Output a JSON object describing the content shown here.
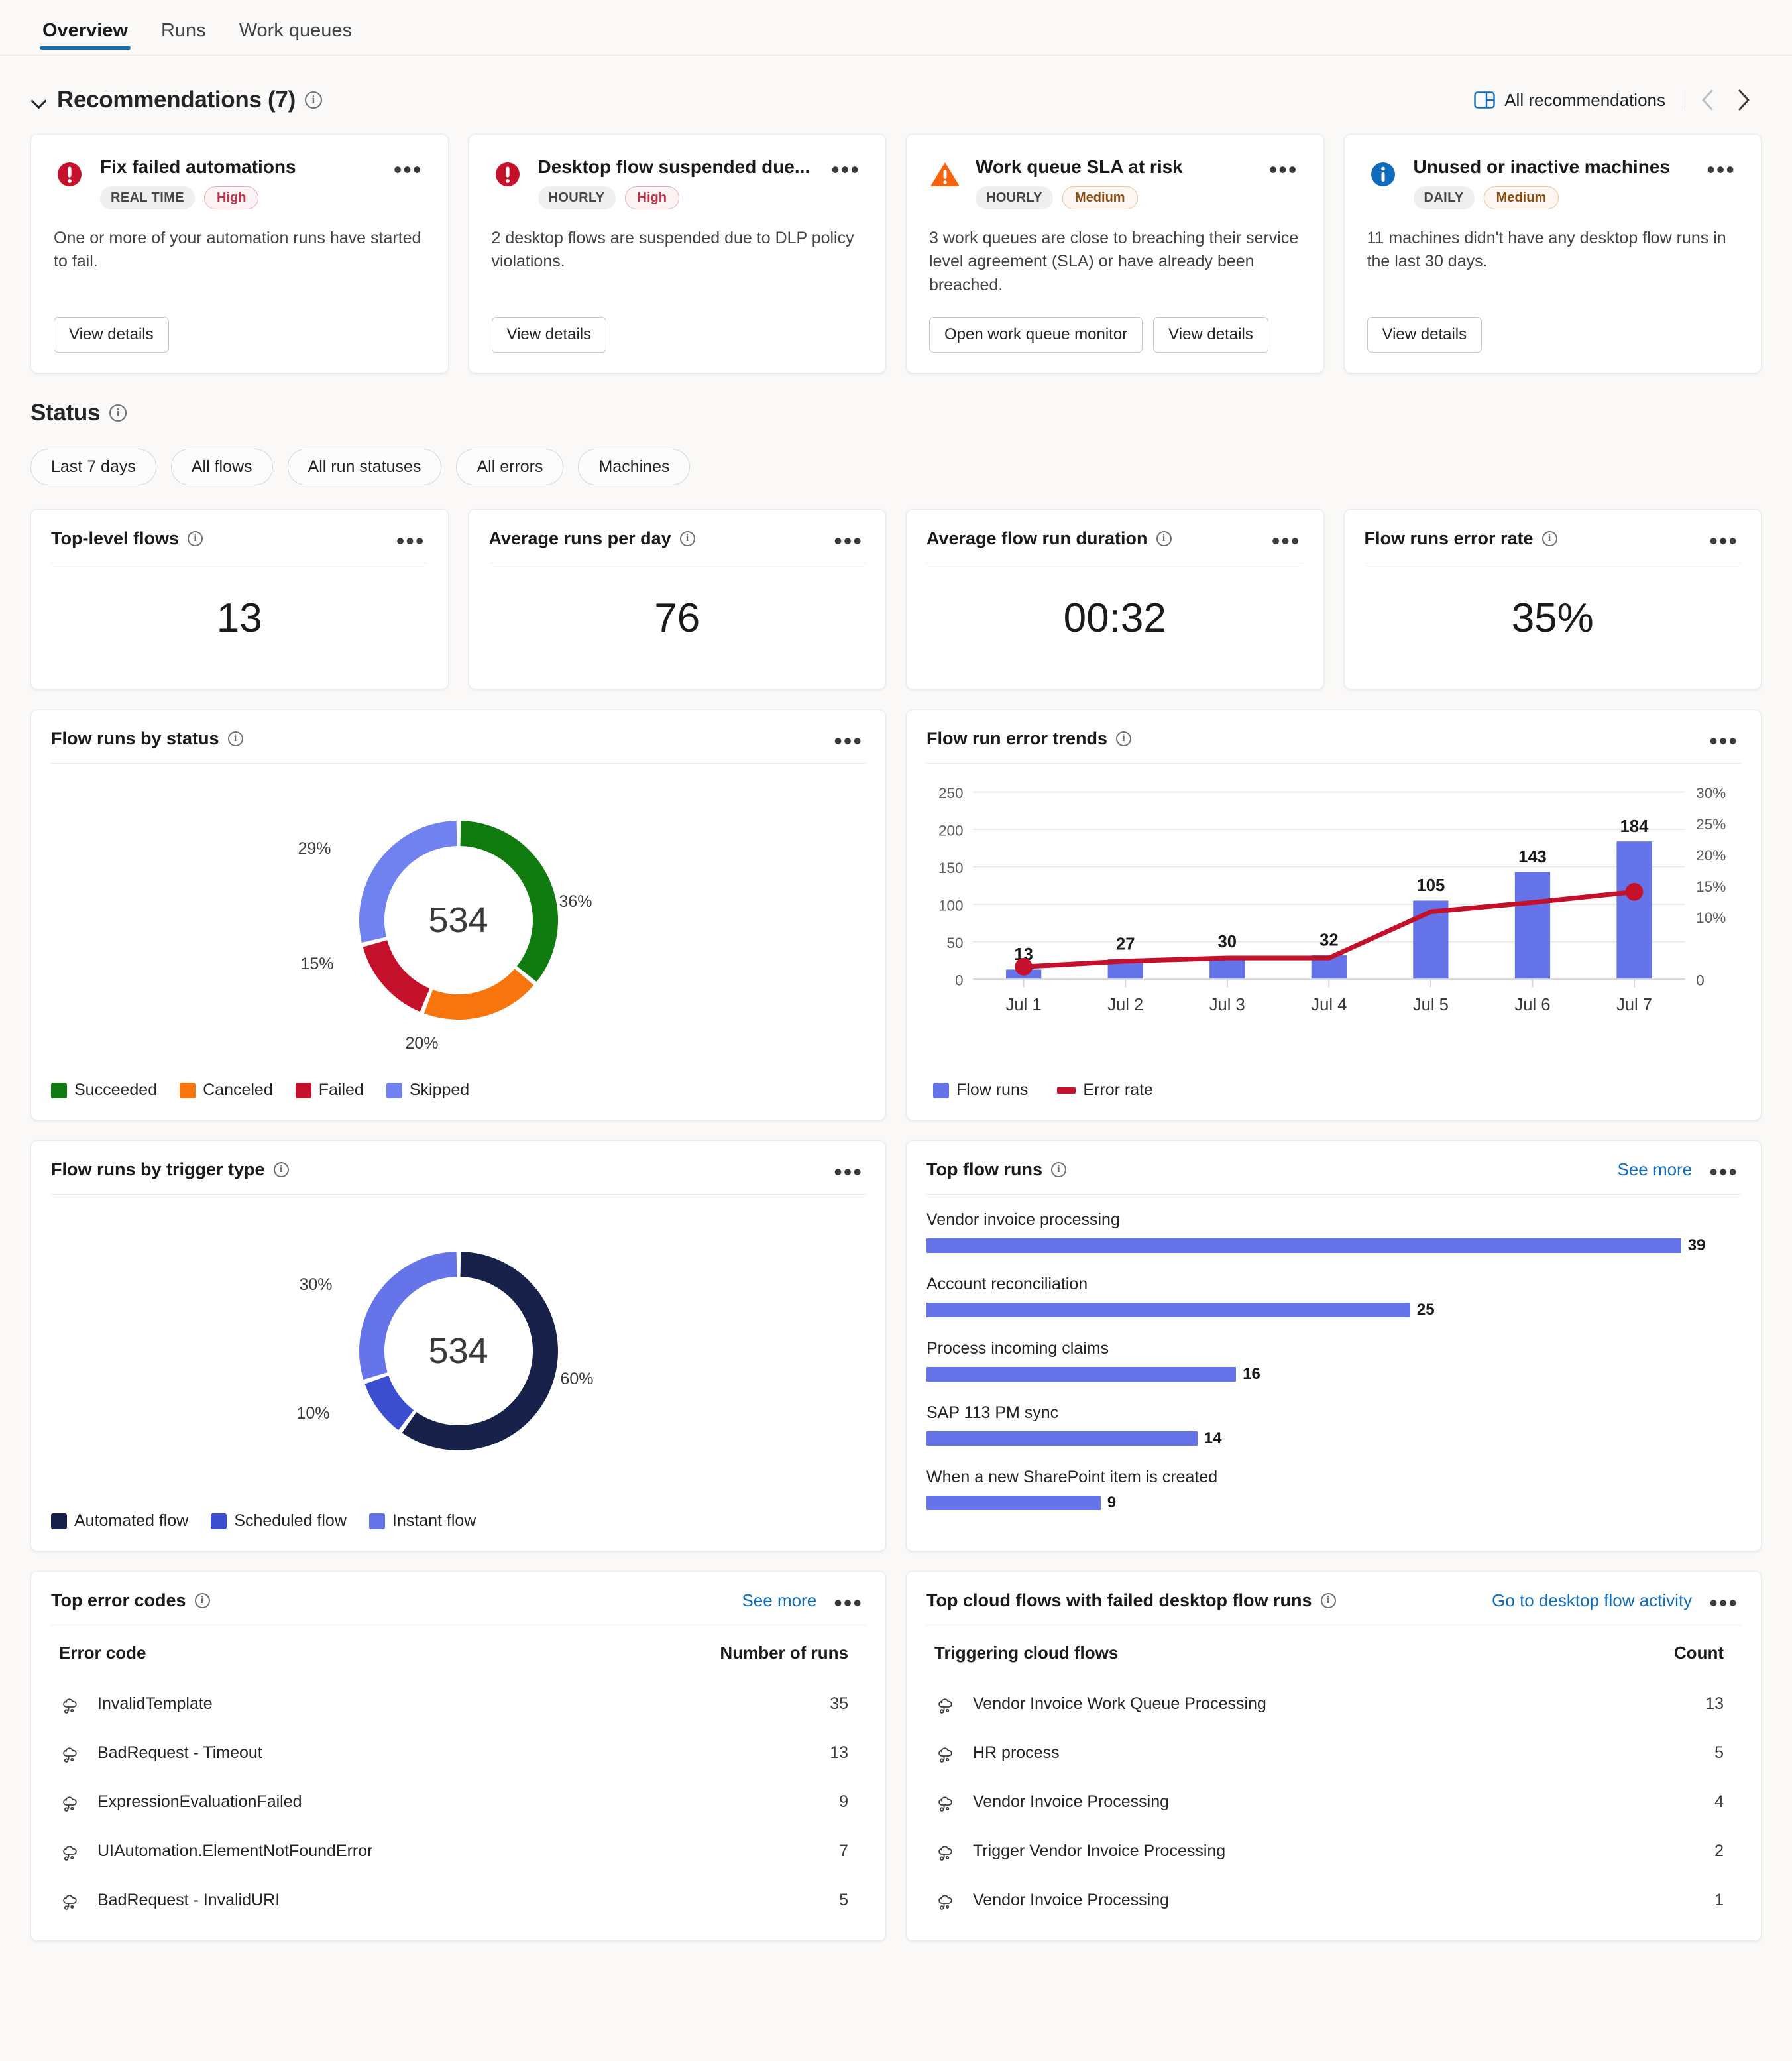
{
  "tabs": [
    {
      "label": "Overview",
      "active": true
    },
    {
      "label": "Runs",
      "active": false
    },
    {
      "label": "Work queues",
      "active": false
    }
  ],
  "recommendations_section": {
    "title": "Recommendations (7)",
    "all_link": "All recommendations",
    "cards": [
      {
        "severity": "error",
        "title": "Fix failed automations",
        "cadence": "REAL TIME",
        "priority": "High",
        "priority_level": "high",
        "description": "One or more of your automation runs have started to fail.",
        "buttons": [
          "View details"
        ]
      },
      {
        "severity": "error",
        "title": "Desktop flow suspended due...",
        "cadence": "HOURLY",
        "priority": "High",
        "priority_level": "high",
        "description": "2 desktop flows are suspended due to DLP policy violations.",
        "buttons": [
          "View details"
        ]
      },
      {
        "severity": "warning",
        "title": "Work queue SLA at risk",
        "cadence": "HOURLY",
        "priority": "Medium",
        "priority_level": "medium",
        "description": "3 work queues are close to breaching their service level agreement (SLA) or have already been breached.",
        "buttons": [
          "Open work queue monitor",
          "View details"
        ]
      },
      {
        "severity": "info",
        "title": "Unused or inactive machines",
        "cadence": "DAILY",
        "priority": "Medium",
        "priority_level": "medium",
        "description": "11 machines didn't have any desktop flow runs in the last 30 days.",
        "buttons": [
          "View details"
        ]
      }
    ]
  },
  "status_section": {
    "title": "Status",
    "filters": [
      "Last 7 days",
      "All flows",
      "All run statuses",
      "All errors",
      "Machines"
    ],
    "kpis": [
      {
        "title": "Top-level flows",
        "value": "13"
      },
      {
        "title": "Average runs per day",
        "value": "76"
      },
      {
        "title": "Average flow run duration",
        "value": "00:32"
      },
      {
        "title": "Flow runs error rate",
        "value": "35%"
      }
    ]
  },
  "cards": {
    "flow_runs_by_status": {
      "title": "Flow runs by status"
    },
    "flow_run_error_trends": {
      "title": "Flow run error trends"
    },
    "flow_runs_by_trigger_type": {
      "title": "Flow runs by trigger type"
    },
    "top_flow_runs": {
      "title": "Top flow runs",
      "link": "See more"
    },
    "top_error_codes": {
      "title": "Top error codes",
      "link": "See more"
    },
    "top_cloud_flows_failed": {
      "title": "Top cloud flows with failed desktop flow runs",
      "link": "Go to desktop flow activity"
    }
  },
  "chart_data": [
    {
      "id": "flow_runs_by_status",
      "type": "pie",
      "title": "Flow runs by status",
      "center_label": "534",
      "total": 534,
      "categories": [
        "Succeeded",
        "Canceled",
        "Failed",
        "Skipped"
      ],
      "values": [
        36,
        20,
        15,
        29
      ],
      "value_labels": [
        "36%",
        "20%",
        "15%",
        "29%"
      ],
      "colors": [
        "#107c10",
        "#f7750c",
        "#c4102b",
        "#7082ef"
      ],
      "legend_position": "bottom"
    },
    {
      "id": "flow_run_error_trends",
      "type": "bar",
      "title": "Flow run error trends",
      "categories": [
        "Jul 1",
        "Jul 2",
        "Jul 3",
        "Jul 4",
        "Jul 5",
        "Jul 6",
        "Jul 7"
      ],
      "series": [
        {
          "name": "Flow runs",
          "type": "bar",
          "color": "#6574e8",
          "values": [
            13,
            27,
            30,
            32,
            105,
            143,
            184
          ],
          "labels": [
            "13",
            "27",
            "30",
            "32",
            "105",
            "143",
            "184"
          ]
        },
        {
          "name": "Error rate",
          "type": "line",
          "color": "#c4102b",
          "values": [
            2.0,
            2.9,
            3.4,
            3.4,
            10.8,
            12.3,
            14.0
          ],
          "unit": "%"
        }
      ],
      "ylabel": "",
      "xlabel": "",
      "ylim": [
        0,
        250
      ],
      "yticks": [
        "0",
        "50",
        "100",
        "150",
        "200",
        "250"
      ],
      "y2lim": [
        0,
        30
      ],
      "y2ticks": [
        "0",
        "5%",
        "10%",
        "15%",
        "20%",
        "25%",
        "30%"
      ],
      "y2ticks_display": [
        "0",
        "",
        "10%",
        "15%",
        "20%",
        "25%",
        "30%"
      ],
      "grid": true,
      "legend_position": "bottom"
    },
    {
      "id": "flow_runs_by_trigger_type",
      "type": "pie",
      "title": "Flow runs by trigger type",
      "center_label": "534",
      "total": 534,
      "categories": [
        "Automated flow",
        "Scheduled flow",
        "Instant flow"
      ],
      "values": [
        60,
        10,
        30
      ],
      "value_labels": [
        "60%",
        "10%",
        "30%"
      ],
      "colors": [
        "#17214a",
        "#3b4ed0",
        "#6574e8"
      ],
      "legend_position": "bottom"
    },
    {
      "id": "top_flow_runs",
      "type": "bar",
      "orientation": "horizontal",
      "title": "Top flow runs",
      "categories": [
        "Vendor invoice processing",
        "Account reconciliation",
        "Process incoming claims",
        "SAP 113 PM sync",
        "When a new SharePoint item is created"
      ],
      "values": [
        39,
        25,
        16,
        14,
        9
      ],
      "color": "#6574e8",
      "xlim": [
        0,
        40
      ]
    }
  ],
  "tables": {
    "top_error_codes": {
      "columns": [
        "Error code",
        "Number of runs"
      ],
      "rows": [
        {
          "name": "InvalidTemplate",
          "count": "35"
        },
        {
          "name": "BadRequest - Timeout",
          "count": "13"
        },
        {
          "name": "ExpressionEvaluationFailed",
          "count": "9"
        },
        {
          "name": "UIAutomation.ElementNotFoundError",
          "count": "7"
        },
        {
          "name": "BadRequest - InvalidURI",
          "count": "5"
        }
      ]
    },
    "top_cloud_flows_failed": {
      "columns": [
        "Triggering cloud flows",
        "Count"
      ],
      "rows": [
        {
          "name": "Vendor Invoice Work Queue Processing",
          "count": "13"
        },
        {
          "name": "HR process",
          "count": "5"
        },
        {
          "name": "Vendor Invoice Processing",
          "count": "4"
        },
        {
          "name": "Trigger Vendor Invoice Processing",
          "count": "2"
        },
        {
          "name": "Vendor Invoice Processing",
          "count": "1"
        }
      ]
    }
  },
  "colors": {
    "accent": "#0f6cbd",
    "error": "#c4102b",
    "warning": "#f7630c",
    "info": "#0f6cbd",
    "success": "#107c10",
    "bar": "#6574e8"
  }
}
